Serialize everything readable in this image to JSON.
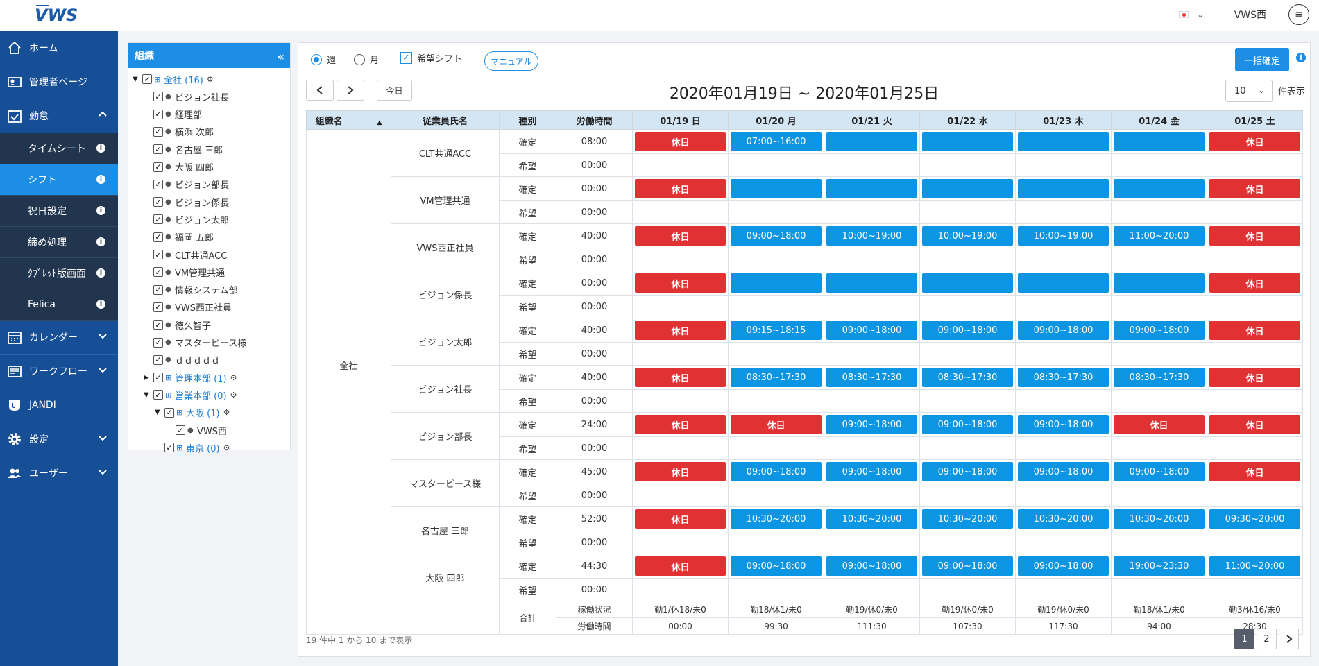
{
  "app": {
    "logo": "VWS",
    "user": "VWS西",
    "menu_icon": "menu-icon"
  },
  "colors": {
    "sidebar": "#174f96",
    "accent": "#1c8ee6",
    "holiday": "#e03232",
    "shift": "#0c95e2"
  },
  "sidebar": {
    "items": [
      {
        "label": "ホーム",
        "icon": "home-icon"
      },
      {
        "label": "管理者ページ",
        "icon": "admin-icon"
      },
      {
        "label": "勤怠",
        "icon": "calendar-check-icon"
      }
    ],
    "sub": [
      {
        "label": "タイムシート"
      },
      {
        "label": "シフト"
      },
      {
        "label": "祝日設定"
      },
      {
        "label": "締め処理"
      },
      {
        "label": "ﾀﾌﾞﾚｯﾄ版画面"
      },
      {
        "label": "Felica"
      }
    ],
    "items2": [
      {
        "label": "カレンダー",
        "icon": "calendar-icon"
      },
      {
        "label": "ワークフロー",
        "icon": "workflow-icon"
      },
      {
        "label": "JANDI",
        "icon": "jandi-icon"
      },
      {
        "label": "設定",
        "icon": "gear-icon"
      },
      {
        "label": "ユーザー",
        "icon": "users-icon"
      }
    ]
  },
  "tree": {
    "title": "組織",
    "nodes": [
      {
        "label": "全社 (16)",
        "type": "org",
        "level": 0,
        "open": true,
        "gear": true
      },
      {
        "label": "ビジョン社長",
        "type": "person",
        "level": 1
      },
      {
        "label": "経理部",
        "type": "person",
        "level": 1
      },
      {
        "label": "横浜 次郎",
        "type": "person",
        "level": 1
      },
      {
        "label": "名古屋 三郎",
        "type": "person",
        "level": 1
      },
      {
        "label": "大阪 四郎",
        "type": "person",
        "level": 1
      },
      {
        "label": "ビジョン部長",
        "type": "person",
        "level": 1
      },
      {
        "label": "ビジョン係長",
        "type": "person",
        "level": 1
      },
      {
        "label": "ビジョン太郎",
        "type": "person",
        "level": 1
      },
      {
        "label": "福岡 五郎",
        "type": "person",
        "level": 1
      },
      {
        "label": "CLT共通ACC",
        "type": "person",
        "level": 1
      },
      {
        "label": "VM管理共通",
        "type": "person",
        "level": 1
      },
      {
        "label": "情報システム部",
        "type": "person",
        "level": 1
      },
      {
        "label": "VWS西正社員",
        "type": "person",
        "level": 1
      },
      {
        "label": "徳久智子",
        "type": "person",
        "level": 1
      },
      {
        "label": "マスターピース様",
        "type": "person",
        "level": 1
      },
      {
        "label": "ｄｄｄｄｄ",
        "type": "person",
        "level": 1
      },
      {
        "label": "管理本部 (1)",
        "type": "org",
        "level": 1,
        "closed": true,
        "gear": true
      },
      {
        "label": "営業本部 (0)",
        "type": "org",
        "level": 1,
        "open": true,
        "gear": true
      },
      {
        "label": "大阪 (1)",
        "type": "org",
        "level": 2,
        "open": true,
        "gear": true
      },
      {
        "label": "VWS西",
        "type": "person",
        "level": 3
      },
      {
        "label": "東京 (0)",
        "type": "org",
        "level": 2,
        "gear": true
      }
    ]
  },
  "toolbar": {
    "week": "週",
    "month": "月",
    "wish_shift": "希望シフト",
    "manual": "マニュアル",
    "bulk_confirm": "一括確定",
    "today": "今日",
    "date_range": "2020年01月19日 ~ 2020年01月25日",
    "page_size": "10",
    "page_size_label": "件表示"
  },
  "table": {
    "headers": [
      "組織名",
      "従業員氏名",
      "種別",
      "労働時間",
      "01/19 日",
      "01/20 月",
      "01/21 火",
      "01/22 水",
      "01/23 木",
      "01/24 金",
      "01/25 土"
    ],
    "org": "全社",
    "type_confirmed": "確定",
    "type_wish": "希望",
    "wish_hours": "00:00",
    "rows": [
      {
        "name": "CLT共通ACC",
        "hours": "08:00",
        "days": [
          {
            "k": "red",
            "t": "休日"
          },
          {
            "k": "blue",
            "t": "07:00~16:00"
          },
          {
            "k": "blue",
            "t": ""
          },
          {
            "k": "blue",
            "t": ""
          },
          {
            "k": "blue",
            "t": ""
          },
          {
            "k": "blue",
            "t": ""
          },
          {
            "k": "red",
            "t": "休日"
          }
        ]
      },
      {
        "name": "VM管理共通",
        "hours": "00:00",
        "days": [
          {
            "k": "red",
            "t": "休日"
          },
          {
            "k": "blue",
            "t": ""
          },
          {
            "k": "blue",
            "t": ""
          },
          {
            "k": "blue",
            "t": ""
          },
          {
            "k": "blue",
            "t": ""
          },
          {
            "k": "blue",
            "t": ""
          },
          {
            "k": "red",
            "t": "休日"
          }
        ]
      },
      {
        "name": "VWS西正社員",
        "hours": "40:00",
        "days": [
          {
            "k": "red",
            "t": "休日"
          },
          {
            "k": "blue",
            "t": "09:00~18:00"
          },
          {
            "k": "blue",
            "t": "10:00~19:00"
          },
          {
            "k": "blue",
            "t": "10:00~19:00"
          },
          {
            "k": "blue",
            "t": "10:00~19:00"
          },
          {
            "k": "blue",
            "t": "11:00~20:00"
          },
          {
            "k": "red",
            "t": "休日"
          }
        ]
      },
      {
        "name": "ビジョン係長",
        "hours": "00:00",
        "days": [
          {
            "k": "red",
            "t": "休日"
          },
          {
            "k": "blue",
            "t": ""
          },
          {
            "k": "blue",
            "t": ""
          },
          {
            "k": "blue",
            "t": ""
          },
          {
            "k": "blue",
            "t": ""
          },
          {
            "k": "blue",
            "t": ""
          },
          {
            "k": "red",
            "t": "休日"
          }
        ]
      },
      {
        "name": "ビジョン太郎",
        "hours": "40:00",
        "days": [
          {
            "k": "red",
            "t": "休日"
          },
          {
            "k": "blue",
            "t": "09:15~18:15"
          },
          {
            "k": "blue",
            "t": "09:00~18:00"
          },
          {
            "k": "blue",
            "t": "09:00~18:00"
          },
          {
            "k": "blue",
            "t": "09:00~18:00"
          },
          {
            "k": "blue",
            "t": "09:00~18:00"
          },
          {
            "k": "red",
            "t": "休日"
          }
        ]
      },
      {
        "name": "ビジョン社長",
        "hours": "40:00",
        "days": [
          {
            "k": "red",
            "t": "休日"
          },
          {
            "k": "blue",
            "t": "08:30~17:30"
          },
          {
            "k": "blue",
            "t": "08:30~17:30"
          },
          {
            "k": "blue",
            "t": "08:30~17:30"
          },
          {
            "k": "blue",
            "t": "08:30~17:30"
          },
          {
            "k": "blue",
            "t": "08:30~17:30"
          },
          {
            "k": "red",
            "t": "休日"
          }
        ]
      },
      {
        "name": "ビジョン部長",
        "hours": "24:00",
        "days": [
          {
            "k": "red",
            "t": "休日"
          },
          {
            "k": "red",
            "t": "休日"
          },
          {
            "k": "blue",
            "t": "09:00~18:00"
          },
          {
            "k": "blue",
            "t": "09:00~18:00"
          },
          {
            "k": "blue",
            "t": "09:00~18:00"
          },
          {
            "k": "red",
            "t": "休日"
          },
          {
            "k": "red",
            "t": "休日"
          }
        ]
      },
      {
        "name": "マスターピース様",
        "hours": "45:00",
        "days": [
          {
            "k": "red",
            "t": "休日"
          },
          {
            "k": "blue",
            "t": "09:00~18:00"
          },
          {
            "k": "blue",
            "t": "09:00~18:00"
          },
          {
            "k": "blue",
            "t": "09:00~18:00"
          },
          {
            "k": "blue",
            "t": "09:00~18:00"
          },
          {
            "k": "blue",
            "t": "09:00~18:00"
          },
          {
            "k": "red",
            "t": "休日"
          }
        ]
      },
      {
        "name": "名古屋 三郎",
        "hours": "52:00",
        "days": [
          {
            "k": "red",
            "t": "休日"
          },
          {
            "k": "blue",
            "t": "10:30~20:00"
          },
          {
            "k": "blue",
            "t": "10:30~20:00"
          },
          {
            "k": "blue",
            "t": "10:30~20:00"
          },
          {
            "k": "blue",
            "t": "10:30~20:00"
          },
          {
            "k": "blue",
            "t": "10:30~20:00"
          },
          {
            "k": "blue",
            "t": "09:30~20:00"
          }
        ]
      },
      {
        "name": "大阪 四郎",
        "hours": "44:30",
        "days": [
          {
            "k": "red",
            "t": "休日"
          },
          {
            "k": "blue",
            "t": "09:00~18:00"
          },
          {
            "k": "blue",
            "t": "09:00~18:00"
          },
          {
            "k": "blue",
            "t": "09:00~18:00"
          },
          {
            "k": "blue",
            "t": "09:00~18:00"
          },
          {
            "k": "blue",
            "t": "19:00~23:30"
          },
          {
            "k": "blue",
            "t": "11:00~20:00"
          }
        ]
      }
    ],
    "summary": {
      "label": "合計",
      "status_label": "稼働状況",
      "hours_label": "労働時間",
      "status": [
        "勤1/休18/未0",
        "勤18/休1/未0",
        "勤19/休0/未0",
        "勤19/休0/未0",
        "勤19/休0/未0",
        "勤18/休1/未0",
        "勤3/休16/未0"
      ],
      "hours": [
        "00:00",
        "99:30",
        "111:30",
        "107:30",
        "117:30",
        "94:00",
        "28:30"
      ]
    }
  },
  "footer": {
    "info": "19 件中 1 から 10 まで表示",
    "pages": [
      "1",
      "2"
    ],
    "current": "1"
  }
}
